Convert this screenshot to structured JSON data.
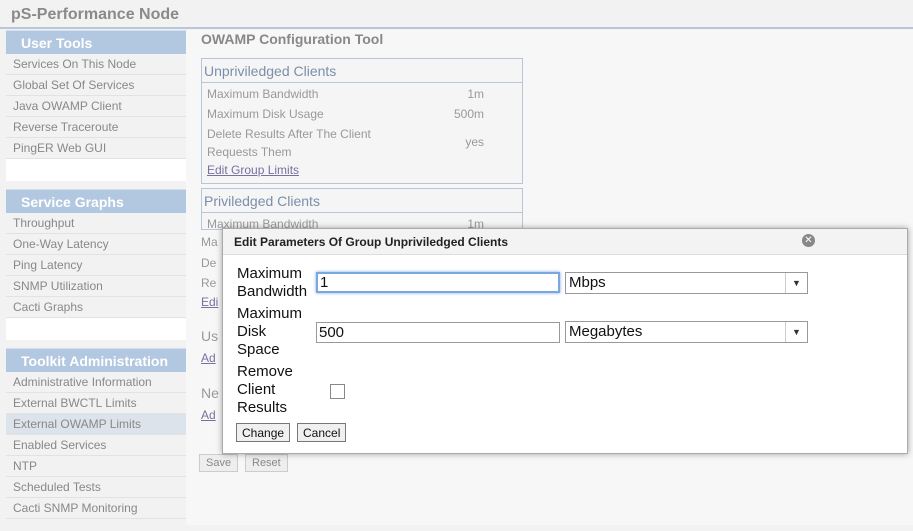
{
  "app": {
    "title": "pS-Performance Node"
  },
  "sidebar": {
    "sections": [
      {
        "header": "User Tools",
        "items": [
          "Services On This Node",
          "Global Set Of Services",
          "Java OWAMP Client",
          "Reverse Traceroute",
          "PingER Web GUI"
        ]
      },
      {
        "header": "Service Graphs",
        "items": [
          "Throughput",
          "One-Way Latency",
          "Ping Latency",
          "SNMP Utilization",
          "Cacti Graphs"
        ]
      },
      {
        "header": "Toolkit Administration",
        "items": [
          "Administrative Information",
          "External BWCTL Limits",
          "External OWAMP Limits",
          "Enabled Services",
          "NTP",
          "Scheduled Tests",
          "Cacti SNMP Monitoring"
        ],
        "active_index": 2
      }
    ]
  },
  "main": {
    "heading": "OWAMP Configuration Tool",
    "groups": [
      {
        "title": "Unpriviledged Clients",
        "rows": [
          {
            "label": "Maximum Bandwidth",
            "value": "1m"
          },
          {
            "label": "Maximum Disk Usage",
            "value": "500m"
          },
          {
            "label": "Delete Results After The Client Requests Them",
            "value": "yes"
          }
        ],
        "link": "Edit Group Limits"
      },
      {
        "title": "Priviledged Clients",
        "rows": [
          {
            "label": "Maximum Bandwidth",
            "value": "1m"
          }
        ]
      }
    ],
    "partials": {
      "ma": "Ma",
      "de": "De",
      "re": "Re",
      "edi": "Edi",
      "us": "Us",
      "ad1": "Ad",
      "ne": "Ne",
      "ad2": "Ad"
    },
    "buttons": {
      "save": "Save",
      "reset": "Reset"
    }
  },
  "dialog": {
    "title": "Edit Parameters Of Group Unpriviledged Clients",
    "close_icon": "close-icon",
    "fields": {
      "bandwidth": {
        "label_1": "Maximum",
        "label_2": "Bandwidth",
        "value": "1",
        "unit": "Mbps"
      },
      "disk": {
        "label_1": "Maximum",
        "label_2": "Disk",
        "label_3": "Space",
        "value": "500",
        "unit": "Megabytes"
      },
      "remove": {
        "label_1": "Remove",
        "label_2": "Client",
        "label_3": "Results",
        "checked": false
      }
    },
    "buttons": {
      "change": "Change",
      "cancel": "Cancel"
    }
  }
}
